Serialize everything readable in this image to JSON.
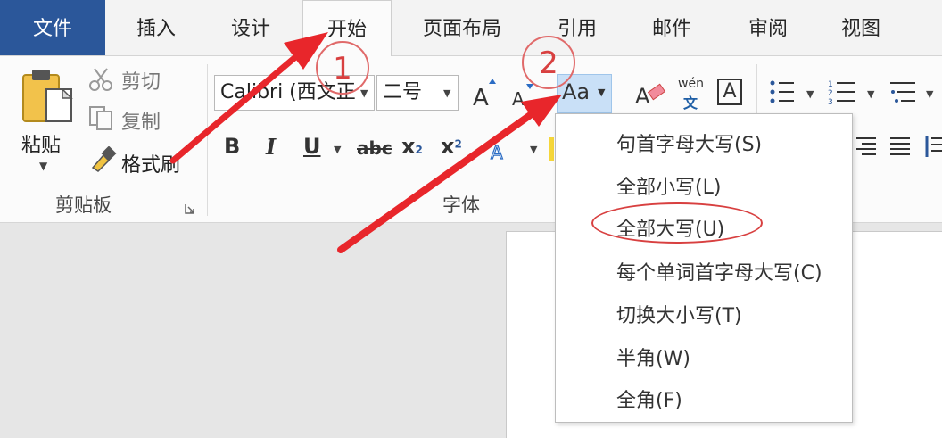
{
  "tabs": {
    "file": "文件",
    "insert": "插入",
    "design": "设计",
    "home": "开始",
    "layout": "页面布局",
    "references": "引用",
    "mailings": "邮件",
    "review": "审阅",
    "view": "视图"
  },
  "clipboard": {
    "paste": "粘贴",
    "cut": "剪切",
    "copy": "复制",
    "format_painter": "格式刷",
    "group_label": "剪贴板"
  },
  "font": {
    "font_name": "Calibri (西文正",
    "font_size": "二号",
    "change_case": "Aa",
    "phonetic_top": "wén",
    "phonetic_bottom": "文",
    "char_border": "A",
    "bold": "B",
    "italic": "I",
    "underline": "U",
    "strikethrough": "abc",
    "subscript": "x",
    "subscript_mark": "2",
    "superscript": "x",
    "superscript_mark": "2",
    "group_label": "字体"
  },
  "annotations": {
    "step1": "1",
    "step2": "2"
  },
  "change_case_menu": [
    "句首字母大写(S)",
    "全部小写(L)",
    "全部大写(U)",
    "每个单词首字母大写(C)",
    "切换大小写(T)",
    "半角(W)",
    "全角(F)"
  ],
  "colors": {
    "file_tab": "#2b579a",
    "highlight_circle": "#d84040",
    "change_case_selected": "#c9e0f7"
  }
}
